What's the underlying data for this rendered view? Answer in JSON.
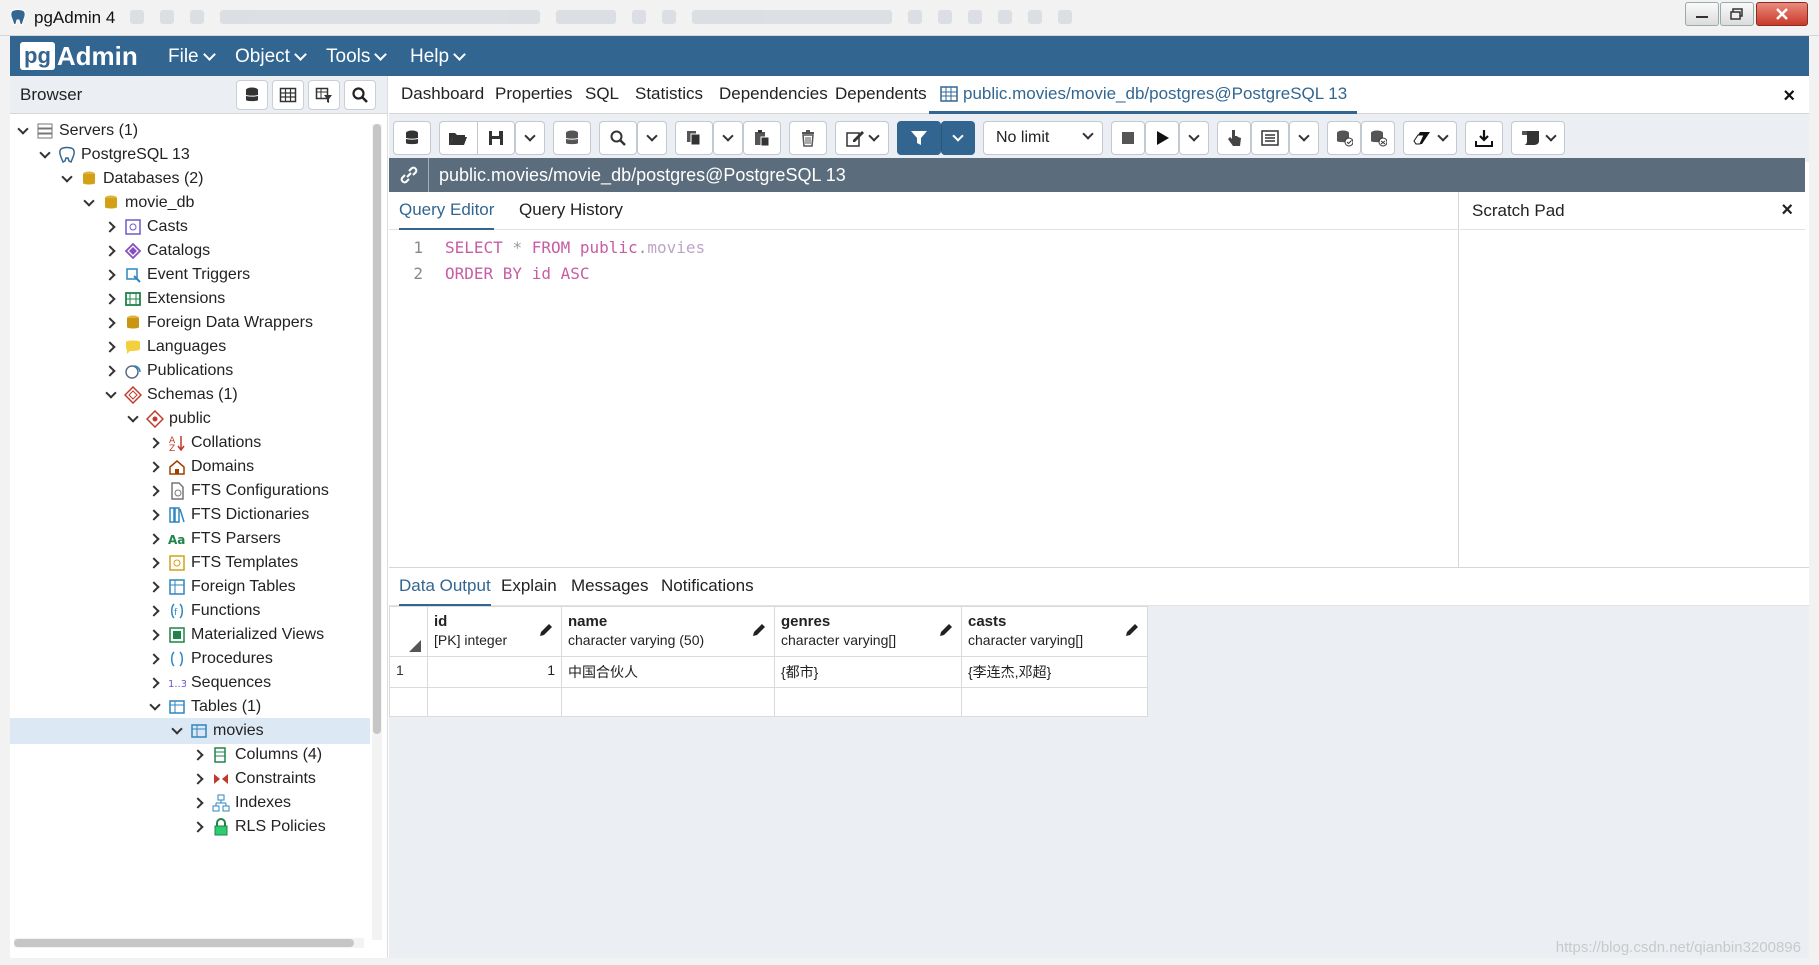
{
  "window": {
    "title": "pgAdmin 4"
  },
  "navbar": {
    "logo_pg": "pg",
    "logo_admin": "Admin",
    "menus": [
      "File",
      "Object",
      "Tools",
      "Help"
    ]
  },
  "browser": {
    "title": "Browser",
    "tree": [
      {
        "label": "Servers (1)"
      },
      {
        "label": "PostgreSQL 13"
      },
      {
        "label": "Databases (2)"
      },
      {
        "label": "movie_db"
      },
      {
        "label": "Casts"
      },
      {
        "label": "Catalogs"
      },
      {
        "label": "Event Triggers"
      },
      {
        "label": "Extensions"
      },
      {
        "label": "Foreign Data Wrappers"
      },
      {
        "label": "Languages"
      },
      {
        "label": "Publications"
      },
      {
        "label": "Schemas (1)"
      },
      {
        "label": "public"
      },
      {
        "label": "Collations"
      },
      {
        "label": "Domains"
      },
      {
        "label": "FTS Configurations"
      },
      {
        "label": "FTS Dictionaries"
      },
      {
        "label": "FTS Parsers"
      },
      {
        "label": "FTS Templates"
      },
      {
        "label": "Foreign Tables"
      },
      {
        "label": "Functions"
      },
      {
        "label": "Materialized Views"
      },
      {
        "label": "Procedures"
      },
      {
        "label": "Sequences"
      },
      {
        "label": "Tables (1)"
      },
      {
        "label": "movies"
      },
      {
        "label": "Columns (4)"
      },
      {
        "label": "Constraints"
      },
      {
        "label": "Indexes"
      },
      {
        "label": "RLS Policies"
      }
    ]
  },
  "main_tabs": {
    "items": [
      "Dashboard",
      "Properties",
      "SQL",
      "Statistics",
      "Dependencies",
      "Dependents"
    ],
    "active": "public.movies/movie_db/postgres@PostgreSQL 13",
    "close": "×"
  },
  "toolbar": {
    "limit_value": "No limit"
  },
  "connection": {
    "label": "public.movies/movie_db/postgres@PostgreSQL 13"
  },
  "editor": {
    "tabs": [
      "Query Editor",
      "Query History"
    ],
    "lines": [
      {
        "num": "1",
        "kw1": "SELECT",
        "op": "*",
        "kw2": "FROM",
        "schema": "public",
        "dot": ".",
        "table": "movies"
      },
      {
        "num": "2",
        "kw1": "ORDER BY",
        "col": "id",
        "kw2": "ASC"
      }
    ]
  },
  "scratch": {
    "title": "Scratch Pad",
    "close": "×"
  },
  "output": {
    "tabs": [
      "Data Output",
      "Explain",
      "Messages",
      "Notifications"
    ],
    "columns": [
      {
        "name": "id",
        "type": "[PK] integer"
      },
      {
        "name": "name",
        "type": "character varying (50)"
      },
      {
        "name": "genres",
        "type": "character varying[]"
      },
      {
        "name": "casts",
        "type": "character varying[]"
      }
    ],
    "rows": [
      {
        "num": "1",
        "id": "1",
        "name": "中国合伙人",
        "genres": "{都市}",
        "casts": "{李连杰,邓超}"
      }
    ],
    "watermark": "https://blog.csdn.net/qianbin3200896"
  }
}
